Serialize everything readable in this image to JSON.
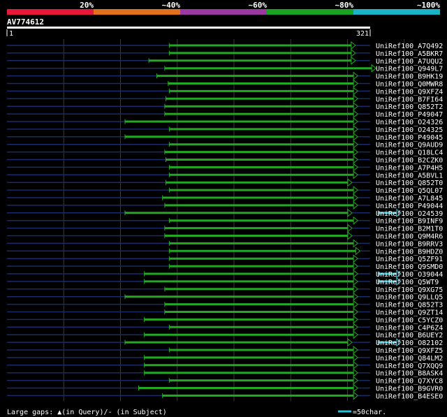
{
  "query_id": "AV774612",
  "query_start": "1",
  "query_end": "321",
  "identity_scale": [
    "20%",
    "~40%",
    "~60%",
    "~80%",
    "~100%"
  ],
  "identity_colors": [
    "#e8183a",
    "#e2701c",
    "#9a3aa0",
    "#1aa320",
    "#1ab4c8"
  ],
  "colors": {
    "hit": "#23a823",
    "gap_marker": "#28c0d8",
    "connector": "#1a2a6a"
  },
  "footer": {
    "legend": "Large gaps: ▲(in Query)/- (in Subject)",
    "scale": "=50char."
  },
  "chart_data": {
    "type": "alignment-overview",
    "query_length": 321,
    "gap_marker_length_chars": 50,
    "hits": [
      {
        "name": "UniRef100_A7Q492",
        "start": 144,
        "end": 308
      },
      {
        "name": "UniRef100_A5BKR7",
        "start": 144,
        "end": 308
      },
      {
        "name": "UniRef100_A7UQU2",
        "start": 126,
        "end": 308
      },
      {
        "name": "UniRef100_Q949L7",
        "start": 140,
        "end": 326
      },
      {
        "name": "UniRef100_B9HK19",
        "start": 133,
        "end": 310
      },
      {
        "name": "UniRef100_Q0MWR8",
        "start": 143,
        "end": 310
      },
      {
        "name": "UniRef100_Q9XFZ4",
        "start": 144,
        "end": 310
      },
      {
        "name": "UniRef100_B7FI64",
        "start": 141,
        "end": 310
      },
      {
        "name": "UniRef100_Q852T2",
        "start": 140,
        "end": 310
      },
      {
        "name": "UniRef100_P49047",
        "start": 140,
        "end": 310
      },
      {
        "name": "UniRef100_O24326",
        "start": 105,
        "end": 310
      },
      {
        "name": "UniRef100_O24325",
        "start": 144,
        "end": 310
      },
      {
        "name": "UniRef100_P49045",
        "start": 105,
        "end": 310
      },
      {
        "name": "UniRef100_Q9AUD9",
        "start": 144,
        "end": 310
      },
      {
        "name": "UniRef100_Q18LC4",
        "start": 140,
        "end": 310
      },
      {
        "name": "UniRef100_B2CZK0",
        "start": 141,
        "end": 310
      },
      {
        "name": "UniRef100_A7P4H5",
        "start": 144,
        "end": 310
      },
      {
        "name": "UniRef100_A5BVL1",
        "start": 144,
        "end": 310
      },
      {
        "name": "UniRef100_Q852T0",
        "start": 141,
        "end": 305
      },
      {
        "name": "UniRef100_Q5QL07",
        "start": 144,
        "end": 310
      },
      {
        "name": "UniRef100_A7L845",
        "start": 138,
        "end": 310
      },
      {
        "name": "UniRef100_P49044",
        "start": 140,
        "end": 310
      },
      {
        "name": "UniRef100_O24539",
        "start": 105,
        "end": 305,
        "gaps": [
          {
            "start": 328,
            "end": 348
          }
        ]
      },
      {
        "name": "UniRef100_B9INF9",
        "start": 144,
        "end": 310
      },
      {
        "name": "UniRef100_B2M1T0",
        "start": 140,
        "end": 305
      },
      {
        "name": "UniRef100_Q9M4R6",
        "start": 140,
        "end": 305
      },
      {
        "name": "UniRef100_B9RRV3",
        "start": 144,
        "end": 310
      },
      {
        "name": "UniRef100_B9HDZ0",
        "start": 144,
        "end": 312
      },
      {
        "name": "UniRef100_Q5ZF91",
        "start": 144,
        "end": 310
      },
      {
        "name": "UniRef100_Q9SMD0",
        "start": 144,
        "end": 310
      },
      {
        "name": "UniRef100_O39044",
        "start": 122,
        "end": 310,
        "gaps": [
          {
            "start": 328,
            "end": 348
          }
        ]
      },
      {
        "name": "UniRef100_Q5WT9",
        "start": 122,
        "end": 310,
        "gaps": [
          {
            "start": 328,
            "end": 348
          }
        ]
      },
      {
        "name": "UniRef100_Q9XG75",
        "start": 140,
        "end": 310
      },
      {
        "name": "UniRef100_Q9LLQ5",
        "start": 105,
        "end": 310
      },
      {
        "name": "UniRef100_Q852T3",
        "start": 140,
        "end": 310
      },
      {
        "name": "UniRef100_Q9ZT14",
        "start": 140,
        "end": 310
      },
      {
        "name": "UniRef100_C5YCZ0",
        "start": 122,
        "end": 310
      },
      {
        "name": "UniRef100_C4P6Z4",
        "start": 144,
        "end": 310
      },
      {
        "name": "UniRef100_B6UEY2",
        "start": 122,
        "end": 310
      },
      {
        "name": "UniRef100_O82102",
        "start": 105,
        "end": 305,
        "gaps": [
          {
            "start": 328,
            "end": 348
          }
        ]
      },
      {
        "name": "UniRef100_Q9XFZ5",
        "start": 144,
        "end": 310
      },
      {
        "name": "UniRef100_Q84LM2",
        "start": 122,
        "end": 310
      },
      {
        "name": "UniRef100_Q7XQQ9",
        "start": 122,
        "end": 310
      },
      {
        "name": "UniRef100_B8ASK4",
        "start": 122,
        "end": 310
      },
      {
        "name": "UniRef100_Q7XYC8",
        "start": 144,
        "end": 310
      },
      {
        "name": "UniRef100_B9GVR0",
        "start": 117,
        "end": 310
      },
      {
        "name": "UniRef100_B4ESE0",
        "start": 138,
        "end": 310
      }
    ]
  }
}
